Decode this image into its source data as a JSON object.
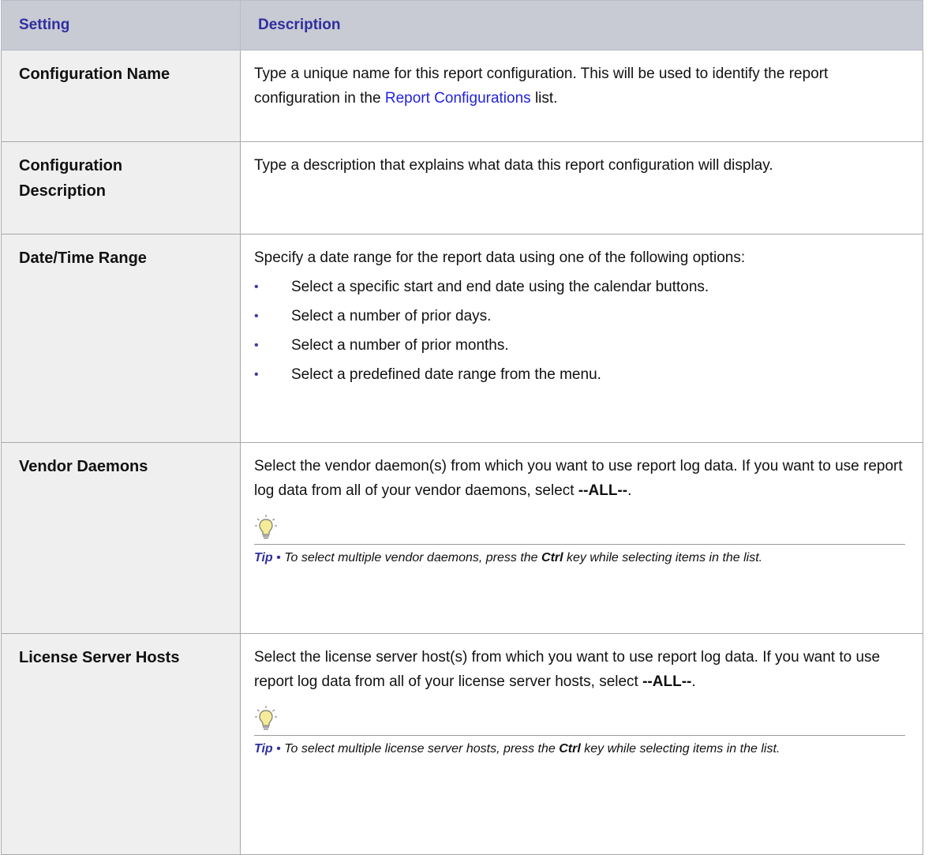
{
  "header": {
    "setting": "Setting",
    "description": "Description"
  },
  "rows": {
    "config_name": {
      "setting": "Configuration Name",
      "desc_pre": "Type a unique name for this report configuration. This will be used to identify the report configuration in the ",
      "desc_link": "Report Configurations",
      "desc_post": " list."
    },
    "config_desc": {
      "setting_line1": "Configuration",
      "setting_line2": "Description",
      "desc": "Type a description that explains what data this report configuration will display."
    },
    "date_range": {
      "setting": "Date/Time Range",
      "desc": "Specify a date range for the report data using one of the following options:",
      "bullet": "•",
      "options": [
        "Select a specific start and end date using the calendar buttons.",
        "Select a number of prior days.",
        "Select a number of prior months.",
        "Select a predefined date range from the menu."
      ]
    },
    "vendor_daemons": {
      "setting": "Vendor Daemons",
      "desc_pre": "Select the vendor daemon(s) from which you want to use report log data. If you want to use report log data from all of your vendor daemons, select ",
      "desc_bold": "--ALL--",
      "desc_post": ".",
      "tip_label": "Tip",
      "tip_bullet": " • ",
      "tip_pre": "To select multiple vendor daemons, press the ",
      "tip_key": "Ctrl",
      "tip_post": " key while selecting items in the list."
    },
    "license_hosts": {
      "setting": "License Server Hosts",
      "desc_pre": "Select the license server host(s) from which you want to use report log data. If you want to use report log data from all of your license server hosts, select ",
      "desc_bold": "--ALL--",
      "desc_post": ".",
      "tip_label": "Tip",
      "tip_bullet": " • ",
      "tip_pre": "To select multiple license server hosts, press the ",
      "tip_key": "Ctrl",
      "tip_post": " key while selecting items in the list."
    }
  },
  "colors": {
    "header_bg": "#c8cad4",
    "header_text": "#2f2f9e",
    "setting_bg": "#efefef",
    "link": "#2222dd",
    "bullet": "#3a3aaa",
    "tip_icon": "#f5ec9a"
  },
  "icons": {
    "tip": "lightbulb-icon"
  }
}
